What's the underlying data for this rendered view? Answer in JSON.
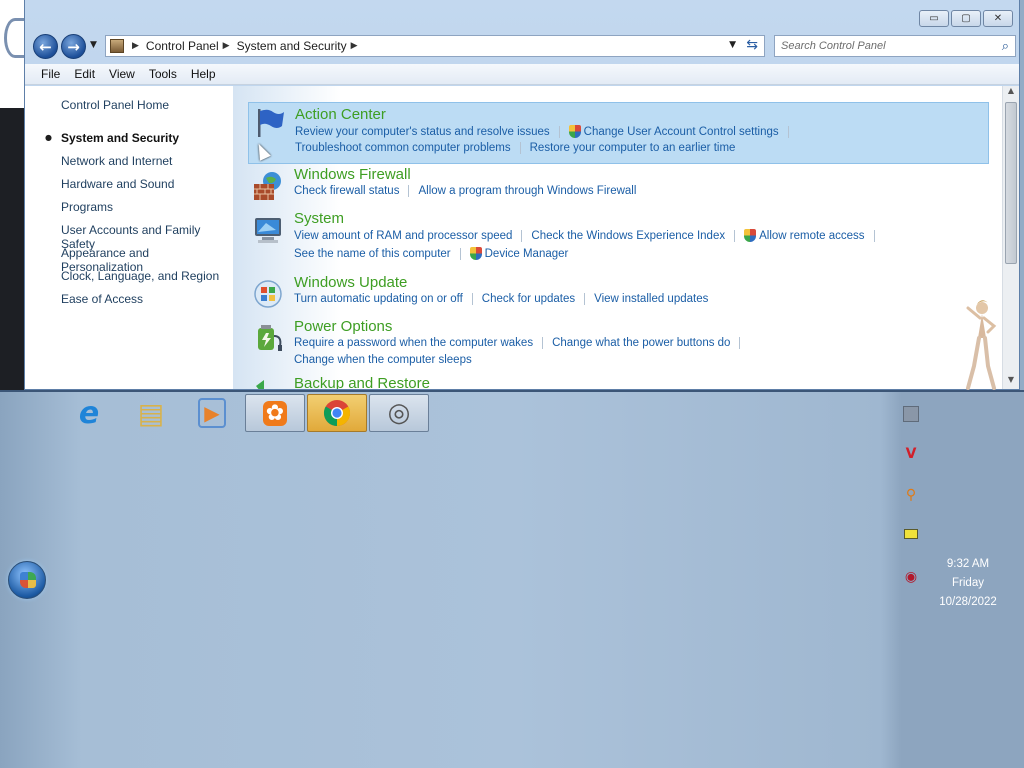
{
  "window": {
    "caption_buttons": {
      "minimize": "▭",
      "maximize": "▢",
      "close": "✕"
    }
  },
  "navigation": {
    "breadcrumb": [
      "Control Panel",
      "System and Security"
    ],
    "search_placeholder": "Search Control Panel"
  },
  "menu": [
    "File",
    "Edit",
    "View",
    "Tools",
    "Help"
  ],
  "left_pane": {
    "home": "Control Panel Home",
    "items": [
      {
        "label": "System and Security",
        "active": true
      },
      {
        "label": "Network and Internet"
      },
      {
        "label": "Hardware and Sound"
      },
      {
        "label": "Programs"
      },
      {
        "label": "User Accounts and Family Safety"
      },
      {
        "label": "Appearance and Personalization"
      },
      {
        "label": "Clock, Language, and Region"
      },
      {
        "label": "Ease of Access"
      }
    ]
  },
  "categories": [
    {
      "title": "Action Center",
      "icon": "flag-icon",
      "highlighted": true,
      "links": [
        [
          "Review your computer's status and resolve issues",
          "Change User Account Control settings"
        ],
        [
          "Troubleshoot common computer problems",
          "Restore your computer to an earlier time"
        ]
      ]
    },
    {
      "title": "Windows Firewall",
      "icon": "firewall-icon",
      "links": [
        [
          "Check firewall status",
          "Allow a program through Windows Firewall"
        ]
      ]
    },
    {
      "title": "System",
      "icon": "system-icon",
      "links": [
        [
          "View amount of RAM and processor speed",
          "Check the Windows Experience Index",
          "Allow remote access"
        ],
        [
          "See the name of this computer",
          "Device Manager"
        ]
      ]
    },
    {
      "title": "Windows Update",
      "icon": "windows-update-icon",
      "links": [
        [
          "Turn automatic updating on or off",
          "Check for updates",
          "View installed updates"
        ]
      ]
    },
    {
      "title": "Power Options",
      "icon": "power-options-icon",
      "links": [
        [
          "Require a password when the computer wakes",
          "Change what the power buttons do"
        ],
        [
          "Change when the computer sleeps"
        ]
      ]
    },
    {
      "title": "Backup and Restore",
      "icon": "backup-icon",
      "links": []
    }
  ],
  "taskbar": {
    "pinned": [
      {
        "name": "internet-explorer",
        "glyph": "e",
        "color": "#1f84d8"
      },
      {
        "name": "windows-explorer",
        "glyph": "▤",
        "color": "#d9b24a"
      },
      {
        "name": "media-player",
        "glyph": "▶",
        "color": "#e8822b"
      },
      {
        "name": "uc-browser",
        "glyph": "✿",
        "color": "#f07a1a",
        "open": true
      },
      {
        "name": "chrome",
        "glyph": "◉",
        "color": "#4a86e8",
        "open": true,
        "active": true
      },
      {
        "name": "steering-app",
        "glyph": "◎",
        "color": "#555555",
        "open": true
      }
    ]
  },
  "tray": {
    "icons": [
      "network-icon",
      "antivirus-icon",
      "search-tool-icon",
      "message-icon",
      "volume-icon"
    ],
    "time": "9:32 AM",
    "day": "Friday",
    "date": "10/28/2022"
  }
}
